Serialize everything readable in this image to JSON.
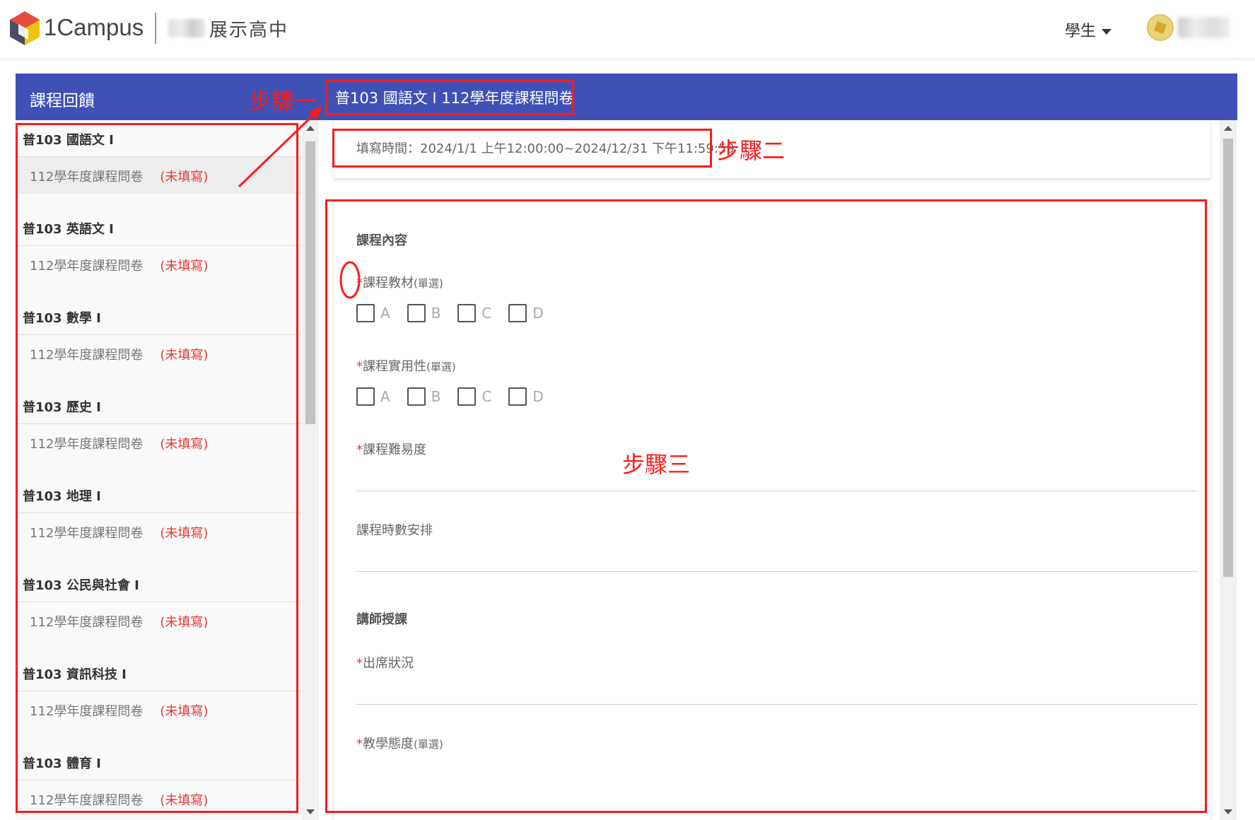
{
  "header": {
    "logo_text": "1Campus",
    "school_name": "展示高中",
    "role": "學生"
  },
  "bluebar": {
    "title": "課程回饋",
    "survey_title": "普103 國語文 I 112學年度課程問卷"
  },
  "sidebar": {
    "courses": [
      {
        "title": "普103 國語文 I",
        "item": "112學年度課程問卷",
        "status": "(未填寫)"
      },
      {
        "title": "普103 英語文 I",
        "item": "112學年度課程問卷",
        "status": "(未填寫)"
      },
      {
        "title": "普103 數學 I",
        "item": "112學年度課程問卷",
        "status": "(未填寫)"
      },
      {
        "title": "普103 歷史 I",
        "item": "112學年度課程問卷",
        "status": "(未填寫)"
      },
      {
        "title": "普103 地理 I",
        "item": "112學年度課程問卷",
        "status": "(未填寫)"
      },
      {
        "title": "普103 公民與社會 I",
        "item": "112學年度課程問卷",
        "status": "(未填寫)"
      },
      {
        "title": "普103 資訊科技 I",
        "item": "112學年度課程問卷",
        "status": "(未填寫)"
      },
      {
        "title": "普103 體育 I",
        "item": "112學年度課程問卷",
        "status": "(未填寫)"
      }
    ]
  },
  "form": {
    "fill_time": "填寫時間：2024/1/1 上午12:00:00~2024/12/31 下午11:59:59",
    "section1": "課程內容",
    "q1": {
      "required": "*",
      "label": "課程教材",
      "hint": "(單選)"
    },
    "q2": {
      "required": "*",
      "label": "課程實用性",
      "hint": "(單選)"
    },
    "q3": {
      "required": "*",
      "label": "課程難易度"
    },
    "q4": {
      "label": "課程時數安排"
    },
    "section2": "講師授課",
    "q5": {
      "required": "*",
      "label": "出席狀況"
    },
    "q6": {
      "required": "*",
      "label": "教學態度",
      "hint": "(單選)"
    },
    "options": [
      "A",
      "B",
      "C",
      "D"
    ]
  },
  "annotations": {
    "step1": "步驟一",
    "step2": "步驟二",
    "step3": "步驟三"
  },
  "colors": {
    "primary": "#3f51b5",
    "required": "#e53935",
    "annotation": "#ff1a1a"
  }
}
